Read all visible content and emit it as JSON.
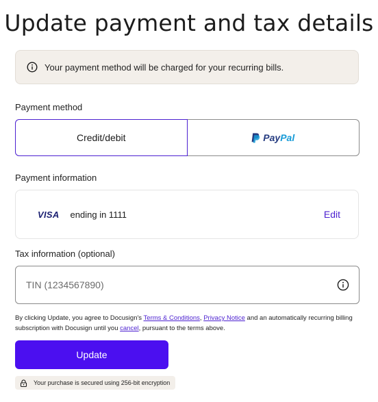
{
  "page": {
    "title": "Update payment and tax details"
  },
  "notice": {
    "text": "Your payment method will be charged for your recurring bills.",
    "icon": "info-icon"
  },
  "payment_method": {
    "label": "Payment method",
    "options": [
      {
        "label": "Credit/debit",
        "selected": true
      },
      {
        "label": "PayPal",
        "selected": false,
        "logo_parts": [
          "Pay",
          "Pal"
        ]
      }
    ]
  },
  "payment_info": {
    "label": "Payment information",
    "card_brand": "VISA",
    "card_ending": "ending in 1111",
    "edit_label": "Edit"
  },
  "tax_info": {
    "label": "Tax information (optional)",
    "placeholder": "TIN (1234567890)",
    "value": "",
    "icon": "info-icon"
  },
  "legal": {
    "prefix": "By clicking Update, you agree to Docusign's ",
    "terms_link": "Terms & Conditions",
    "sep": ", ",
    "privacy_link": "Privacy Notice",
    "middle": " and an automatically recurring billing subscription with Docusign until you ",
    "cancel_link": "cancel",
    "suffix": ", pursuant to the terms above."
  },
  "actions": {
    "update_label": "Update"
  },
  "security": {
    "text": "Your purchase is secured using 256-bit encryption",
    "icon": "lock-icon"
  },
  "colors": {
    "accent": "#4b0ff0",
    "link": "#4b1fd0",
    "notice_bg": "#f3efea"
  }
}
